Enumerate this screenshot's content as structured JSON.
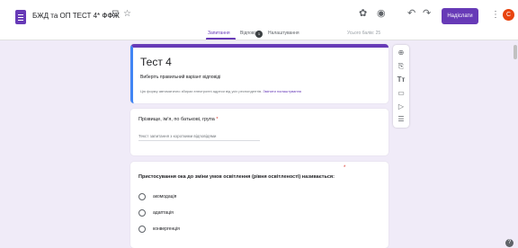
{
  "header": {
    "doc_title": "БЖД та ОП ТЕСТ 4* ФФЖ",
    "send_label": "Надіслати",
    "avatar_letter": "C",
    "icons": [
      "forms-app-icon",
      "move-folder-icon",
      "star-icon",
      "customize-theme-icon",
      "preview-icon",
      "undo-icon",
      "redo-icon",
      "more-vert-icon"
    ]
  },
  "tabs": {
    "items": [
      {
        "label": "Запитання"
      },
      {
        "label": "Відповіді"
      },
      {
        "label": "Налаштування"
      }
    ],
    "responses_count": "1",
    "points_total": "Усього балів: 25"
  },
  "form": {
    "title": "Тест 4",
    "description": "Виберіть правильний варіант відповіді",
    "note_text": "Цю форму автоматично збирає електронні адреси від усіх респондентів.",
    "note_link": "Змінити налаштування"
  },
  "questions": [
    {
      "title": "Прізвище, ім'я, по батькові, група",
      "required_mark": "*",
      "placeholder": "Текст запитання з короткими відповідями"
    },
    {
      "title": "Пристосування ока до зміни умов освітлення (рівня освітленості) називається:",
      "required_mark": "*",
      "options": [
        {
          "label": "акомодація"
        },
        {
          "label": "адаптація"
        },
        {
          "label": "конвергенція"
        }
      ]
    }
  ],
  "side_toolbar": {
    "icons": [
      "add-question-icon",
      "import-questions-icon",
      "add-title-icon",
      "add-image-icon",
      "add-video-icon",
      "add-section-icon"
    ]
  },
  "colors": {
    "accent": "#673ab7",
    "background": "#f0ebf8",
    "required": "#d93025",
    "avatar": "#e8430e"
  }
}
